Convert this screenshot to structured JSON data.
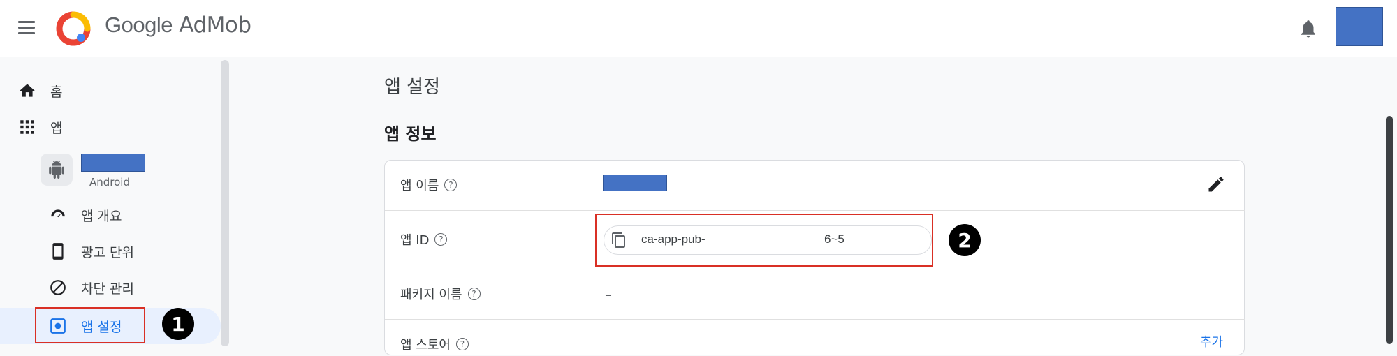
{
  "header": {
    "brand_google": "Google",
    "brand_product": "AdMob",
    "menu_icon": "hamburger-menu-icon",
    "notifications_icon": "bell-icon",
    "avatar_redacted": true
  },
  "sidebar": {
    "home_label": "홈",
    "apps_label": "앱",
    "app_platform": "Android",
    "app_name_redacted": true,
    "items": [
      {
        "label": "앱 개요",
        "icon": "speedometer-icon"
      },
      {
        "label": "광고 단위",
        "icon": "mobile-device-icon"
      },
      {
        "label": "차단 관리",
        "icon": "block-icon"
      },
      {
        "label": "앱 설정",
        "icon": "settings-box-icon"
      }
    ]
  },
  "annotations": {
    "step1": "1",
    "step2": "2"
  },
  "main": {
    "page_title": "앱 설정",
    "section_title": "앱 정보",
    "rows": {
      "app_name_label": "앱 이름",
      "app_id_label": "앱 ID",
      "package_name_label": "패키지 이름",
      "package_name_value": "–",
      "app_store_label": "앱 스토어",
      "app_store_action": "추가"
    },
    "app_id_value_start": "ca-app-pub-",
    "app_id_value_end": "6~5",
    "help_glyph": "?"
  },
  "colors": {
    "accent": "#1a73e8",
    "highlight_box": "#d93025",
    "redaction": "#4472c4"
  }
}
